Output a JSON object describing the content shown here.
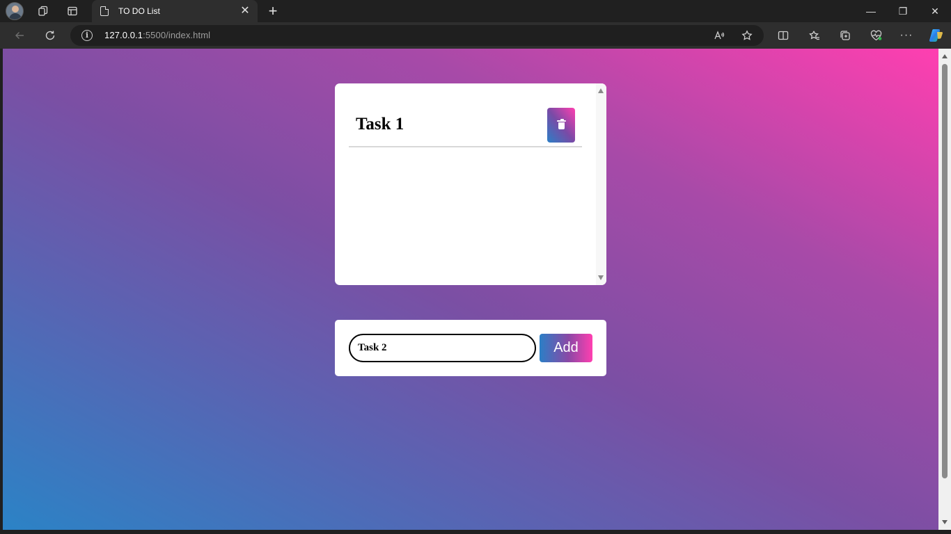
{
  "browser": {
    "tab_title": "TO DO List",
    "tab_close": "✕",
    "new_tab": "+",
    "url_host": "127.0.0.1",
    "url_rest": ":5500/index.html",
    "window_controls": {
      "minimize": "—",
      "restore": "❐",
      "close": "✕"
    },
    "icons": [
      "profile-avatar",
      "workspaces-icon",
      "vertical-tabs-icon",
      "back-icon",
      "refresh-icon",
      "site-info-icon",
      "read-aloud-icon",
      "favorite-star-icon",
      "split-screen-icon",
      "favorites-icon",
      "collections-icon",
      "browser-essentials-icon",
      "more-icon",
      "copilot-icon"
    ]
  },
  "todo": {
    "tasks": [
      {
        "text": "Task 1"
      }
    ],
    "input_value": "Task 2",
    "add_label": "Add"
  },
  "colors": {
    "gradient_start": "#2b83c6",
    "gradient_mid": "#7b4fa4",
    "gradient_end": "#ff3fb0"
  }
}
